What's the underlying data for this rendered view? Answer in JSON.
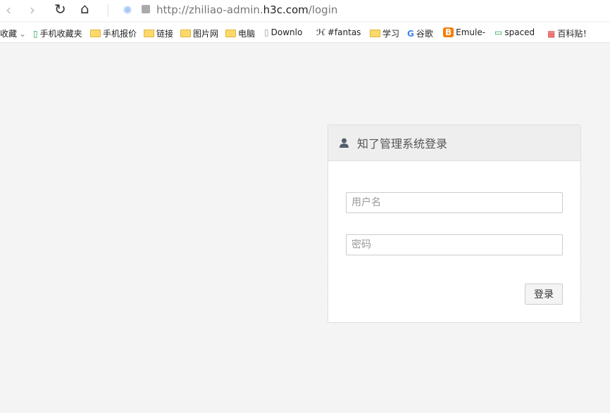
{
  "browser": {
    "url_prefix": "http://zhiliao-admin.",
    "url_host": "h3c.com",
    "url_suffix": "/login"
  },
  "bookmarks": [
    {
      "label": "收藏",
      "icon": "chevron-down-icon"
    },
    {
      "label": "手机收藏夹",
      "icon": "phone-icon"
    },
    {
      "label": "手机报价",
      "icon": "folder-icon"
    },
    {
      "label": "链接",
      "icon": "folder-icon"
    },
    {
      "label": "图片网",
      "icon": "folder-icon"
    },
    {
      "label": "电脑",
      "icon": "folder-icon"
    },
    {
      "label": "Downlo",
      "icon": "page-icon"
    },
    {
      "label": "#fantas",
      "icon": "h-icon"
    },
    {
      "label": "学习",
      "icon": "folder-icon"
    },
    {
      "label": "谷歌",
      "icon": "google-icon"
    },
    {
      "label": "Emule-",
      "icon": "blogger-icon"
    },
    {
      "label": "spaced",
      "icon": "monitor-icon"
    },
    {
      "label": "百科贴！",
      "icon": "seal-icon"
    }
  ],
  "login": {
    "title": "知了管理系统登录",
    "username_placeholder": "用户名",
    "password_placeholder": "密码",
    "submit": "登录"
  }
}
